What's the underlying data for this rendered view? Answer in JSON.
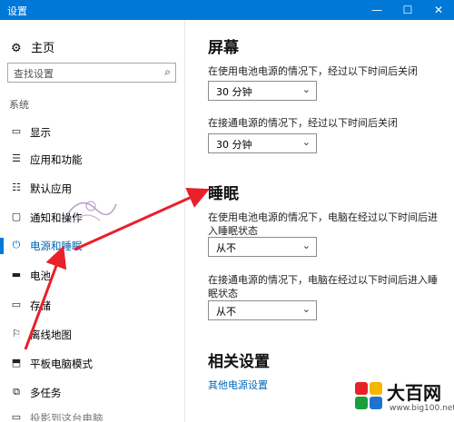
{
  "window": {
    "title": "设置",
    "min": "—",
    "max": "☐",
    "close": "✕"
  },
  "sidebar": {
    "home": "主页",
    "search_placeholder": "查找设置",
    "section": "系统",
    "items": [
      {
        "label": "显示",
        "icon": "display-icon",
        "glyph": "▭"
      },
      {
        "label": "应用和功能",
        "icon": "apps-icon",
        "glyph": "☰"
      },
      {
        "label": "默认应用",
        "icon": "default-apps-icon",
        "glyph": "☷"
      },
      {
        "label": "通知和操作",
        "icon": "notifications-icon",
        "glyph": "▢"
      },
      {
        "label": "电源和睡眠",
        "icon": "power-icon",
        "glyph": "⏻",
        "active": true
      },
      {
        "label": "电池",
        "icon": "battery-icon",
        "glyph": "▬"
      },
      {
        "label": "存储",
        "icon": "storage-icon",
        "glyph": "▭"
      },
      {
        "label": "离线地图",
        "icon": "map-icon",
        "glyph": "⚐"
      },
      {
        "label": "平板电脑模式",
        "icon": "tablet-icon",
        "glyph": "⬒"
      },
      {
        "label": "多任务",
        "icon": "multitask-icon",
        "glyph": "⧉"
      },
      {
        "label": "投影到这台电脑",
        "icon": "project-icon",
        "glyph": "▭"
      }
    ]
  },
  "main": {
    "screen_heading": "屏幕",
    "screen_battery_label": "在使用电池电源的情况下，经过以下时间后关闭",
    "screen_battery_value": "30 分钟",
    "screen_plugged_label": "在接通电源的情况下，经过以下时间后关闭",
    "screen_plugged_value": "30 分钟",
    "sleep_heading": "睡眠",
    "sleep_battery_label": "在使用电池电源的情况下，电脑在经过以下时间后进入睡眠状态",
    "sleep_battery_value": "从不",
    "sleep_plugged_label": "在接通电源的情况下，电脑在经过以下时间后进入睡眠状态",
    "sleep_plugged_value": "从不",
    "related_heading": "相关设置",
    "other_power_link": "其他电源设置"
  },
  "watermark": {
    "brand": "大百网",
    "url": "www.big100.net"
  },
  "colors": {
    "accent": "#0078d7",
    "link": "#0067b8",
    "arrow": "#e8202a"
  }
}
